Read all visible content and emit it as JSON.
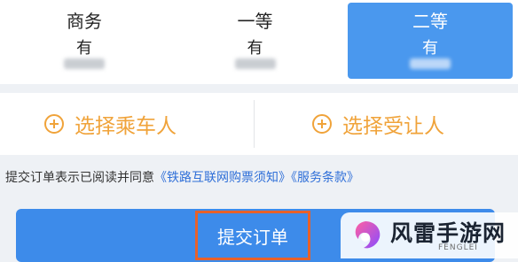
{
  "seat_types": [
    {
      "name": "商务",
      "availability": "有"
    },
    {
      "name": "一等",
      "availability": "有"
    },
    {
      "name": "二等",
      "availability": "有"
    }
  ],
  "passenger_actions": {
    "select_passenger": "选择乘车人",
    "select_transferee": "选择受让人"
  },
  "agreement": {
    "prefix": "提交订单表示已阅读并同意",
    "link_ticket_notice": "《铁路互联网购票须知》",
    "link_terms": "《服务条款》"
  },
  "submit": {
    "label": "提交订单"
  },
  "watermark": {
    "title": "风雷手游网",
    "subtitle": "FENGLEI"
  },
  "colors": {
    "accent_blue": "#4a98ee",
    "submit_blue": "#3d8bea",
    "orange": "#f0a33a",
    "highlight_box": "#e7612a",
    "link_blue": "#2f6fd8"
  }
}
